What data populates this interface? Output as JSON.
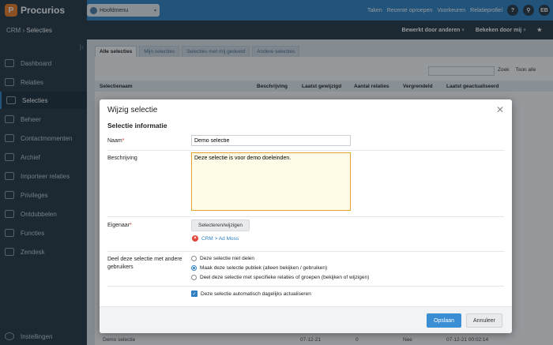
{
  "app": {
    "name": "Procurios",
    "logo_letter": "P"
  },
  "topbar": {
    "mainmenu": "Hoofdmenu",
    "links": [
      "Taken",
      "Recente oproepen",
      "Voorkeuren",
      "Relatieprofiel"
    ],
    "help": "?",
    "search": "⚲",
    "user": "EB"
  },
  "breadcrumb": {
    "root": "CRM",
    "sep": "›",
    "current": "Selecties"
  },
  "subbar": {
    "edited_by": "Bewerkt door anderen",
    "viewed_by": "Bekeken door mij",
    "star": "★"
  },
  "sidebar": {
    "items": [
      {
        "label": "Dashboard"
      },
      {
        "label": "Relaties"
      },
      {
        "label": "Selecties"
      },
      {
        "label": "Beheer"
      },
      {
        "label": "Contactmomenten"
      },
      {
        "label": "Archief"
      },
      {
        "label": "Importeer relaties"
      },
      {
        "label": "Privileges"
      },
      {
        "label": "Ontdubbelen"
      },
      {
        "label": "Functies"
      },
      {
        "label": "Zendesk"
      }
    ],
    "settings": "Instellingen"
  },
  "tabs": [
    "Alle selecties",
    "Mijn selecties",
    "Selecties met mij gedeeld",
    "Andere selecties"
  ],
  "search": {
    "search_label": "Zoek",
    "show_all": "Toon alle"
  },
  "table": {
    "headers": [
      "Selectienaam",
      "Beschrijving",
      "Laatst gewijzigd",
      "Aantal relaties",
      "Vergrendeld",
      "Laatst geactualiseerd"
    ],
    "last_row": {
      "name": "Demo selectie",
      "modified": "07-12-21",
      "count": "0",
      "locked": "Nee",
      "updated": "07-12-21 00:02:14"
    }
  },
  "modal": {
    "title": "Wijzig selectie",
    "section": "Selectie informatie",
    "name_label": "Naam",
    "name_value": "Demo selectie",
    "desc_label": "Beschrijving",
    "desc_value": "Deze selectie is voor demo doeleinden.",
    "owner_label": "Eigenaar",
    "owner_button": "Selecteren/wijzigen",
    "owner_value": "CRM > Ad Moss",
    "share_label": "Deel deze selectie met andere gebruikers",
    "share_options": [
      "Deze selectie niet delen",
      "Maak deze selectie publiek (alleen bekijken / gebruiken)",
      "Deel deze selectie met specifieke relaties of groepen (bekijken of wijzigen)"
    ],
    "auto_update": "Deze selectie automatisch dagelijks actualiseren",
    "save": "Opslaan",
    "cancel": "Annuleer"
  }
}
